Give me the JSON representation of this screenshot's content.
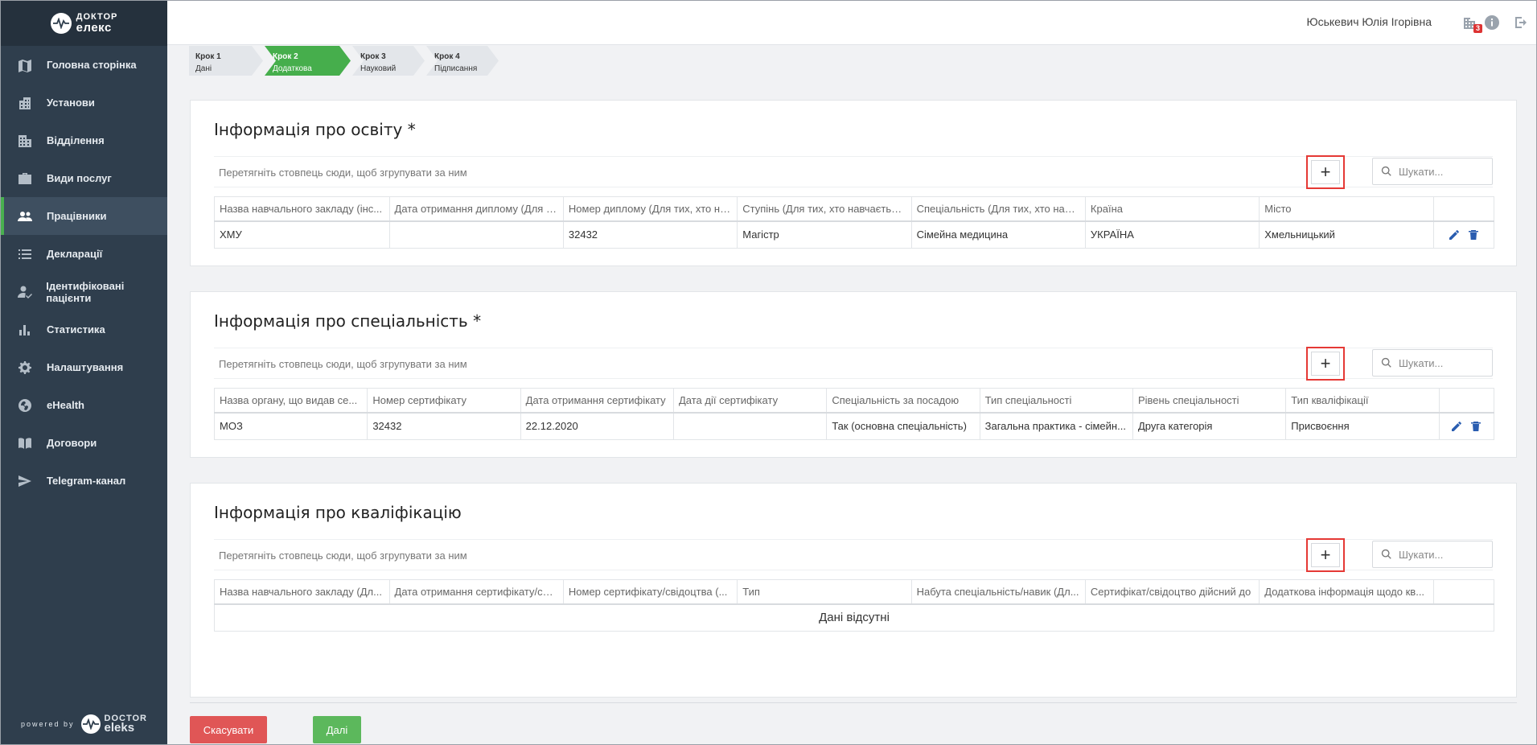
{
  "app": {
    "logo_line1": "ДОКТОР",
    "logo_line2": "елекс",
    "powered_by": "powered by",
    "powered_logo_line1": "DOCTOR",
    "powered_logo_line2": "eleks"
  },
  "sidebar": {
    "items": [
      {
        "label": "Головна сторінка",
        "icon": "map-icon"
      },
      {
        "label": "Установи",
        "icon": "building-icon"
      },
      {
        "label": "Відділення",
        "icon": "office-icon"
      },
      {
        "label": "Види послуг",
        "icon": "briefcase-icon"
      },
      {
        "label": "Працівники",
        "icon": "users-icon",
        "active": true
      },
      {
        "label": "Декларації",
        "icon": "list-icon"
      },
      {
        "label": "Ідентифіковані пацієнти",
        "icon": "user-check-icon"
      },
      {
        "label": "Статистика",
        "icon": "bar-chart-icon"
      },
      {
        "label": "Налаштування",
        "icon": "gear-icon"
      },
      {
        "label": "eHealth",
        "icon": "globe-icon"
      },
      {
        "label": "Договори",
        "icon": "book-icon"
      },
      {
        "label": "Telegram-канал",
        "icon": "send-icon"
      }
    ]
  },
  "header": {
    "user_name": "Юськевич Юлія Ігорівна",
    "notifications_count": "3"
  },
  "stepper": [
    {
      "title": "Крок 1",
      "subtitle": "Дані працівника"
    },
    {
      "title": "Крок 2",
      "subtitle": "Додаткова інформація",
      "active": true
    },
    {
      "title": "Крок 3",
      "subtitle": "Науковий ступінь"
    },
    {
      "title": "Крок 4",
      "subtitle": "Підписання"
    }
  ],
  "common": {
    "group_hint": "Перетягніть стовпець сюди, щоб згрупувати за ним",
    "search_placeholder": "Шукати...",
    "add_symbol": "+"
  },
  "education": {
    "title": "Інформація про освіту *",
    "columns": [
      "Назва навчального закладу (інс...",
      "Дата отримання диплому (Для т...",
      "Номер диплому (Для тих, хто на...",
      "Ступінь (Для тих, хто навчається...",
      "Спеціальність (Для тих, хто навч...",
      "Країна",
      "Місто"
    ],
    "rows": [
      [
        "ХМУ",
        "",
        "32432",
        "Магістр",
        "Сімейна медицина",
        "УКРАЇНА",
        "Хмельницький"
      ]
    ]
  },
  "specialty": {
    "title": "Інформація про спеціальність *",
    "columns": [
      "Назва органу, що видав се...",
      "Номер сертифікату",
      "Дата отримання сертифікату",
      "Дата дії сертифікату",
      "Спеціальність за посадою",
      "Тип спеціальності",
      "Рівень спеціальності",
      "Тип кваліфікації"
    ],
    "rows": [
      [
        "МОЗ",
        "32432",
        "22.12.2020",
        "",
        "Так (основна спеціальність)",
        "Загальна практика - сімейн...",
        "Друга категорія",
        "Присвоєння"
      ]
    ]
  },
  "qualification": {
    "title": "Інформація про кваліфікацію",
    "columns": [
      "Назва навчального закладу (Дл...",
      "Дата отримання сертифікату/сві...",
      "Номер сертифікату/свідоцтва (...",
      "Тип",
      "Набута спеціальність/навик (Дл...",
      "Сертифікат/свідоцтво дійсний до",
      "Додаткова інформація щодо кв..."
    ],
    "empty_text": "Дані відсутні"
  },
  "footer": {
    "cancel_label": "Скасувати",
    "next_label": "Далі"
  },
  "colors": {
    "sidebar": "#2f3e4d",
    "accent_green": "#46ae4c",
    "cancel_red": "#e05656",
    "highlight_red": "#e53935",
    "action_blue": "#2a5db0"
  }
}
